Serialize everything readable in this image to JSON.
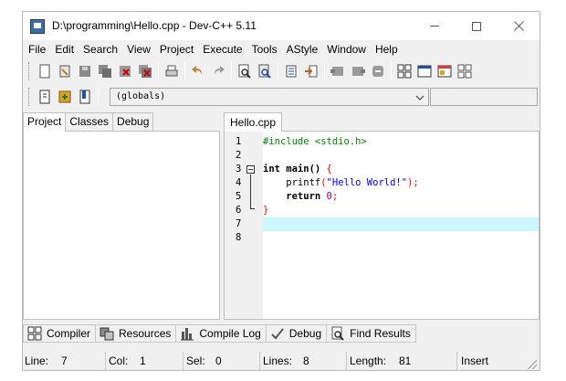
{
  "window": {
    "title": "D:\\programming\\Hello.cpp - Dev-C++ 5.11"
  },
  "menu": [
    "File",
    "Edit",
    "Search",
    "View",
    "Project",
    "Execute",
    "Tools",
    "AStyle",
    "Window",
    "Help"
  ],
  "toolbar": {
    "scope_combo": "(globals)"
  },
  "left_panel": {
    "tabs": [
      "Project",
      "Classes",
      "Debug"
    ],
    "active_tab": "Project"
  },
  "editor": {
    "tab_label": "Hello.cpp",
    "line_numbers": [
      "1",
      "2",
      "3",
      "4",
      "5",
      "6",
      "7",
      "8"
    ],
    "current_line": 7,
    "lines": {
      "l1": "#include <stdio.h>",
      "l3_kw": "int",
      "l3_rest": " main() ",
      "l3_brace": "{",
      "l4_fn": "    printf",
      "l4_paren_open": "(",
      "l4_str": "\"Hello World!\"",
      "l4_paren_close": ");",
      "l5_kw": "    return",
      "l5_sp": " ",
      "l5_num": "0",
      "l5_semi": ";",
      "l6_brace": "}"
    },
    "colors": {
      "current_line_bg": "#ccf7ff",
      "string": "#0000ff",
      "number": "#800080",
      "symbol": "#ff0000",
      "preprocessor": "#008000"
    }
  },
  "bottom_tabs": [
    {
      "label": "Compiler",
      "icon": "compiler-grid-icon"
    },
    {
      "label": "Resources",
      "icon": "resources-icon"
    },
    {
      "label": "Compile Log",
      "icon": "bar-chart-icon"
    },
    {
      "label": "Debug",
      "icon": "check-icon"
    },
    {
      "label": "Find Results",
      "icon": "find-icon"
    }
  ],
  "status": {
    "line_label": "Line:",
    "line_value": "7",
    "col_label": "Col:",
    "col_value": "1",
    "sel_label": "Sel:",
    "sel_value": "0",
    "lines_label": "Lines:",
    "lines_value": "8",
    "length_label": "Length:",
    "length_value": "81",
    "mode": "Insert"
  }
}
